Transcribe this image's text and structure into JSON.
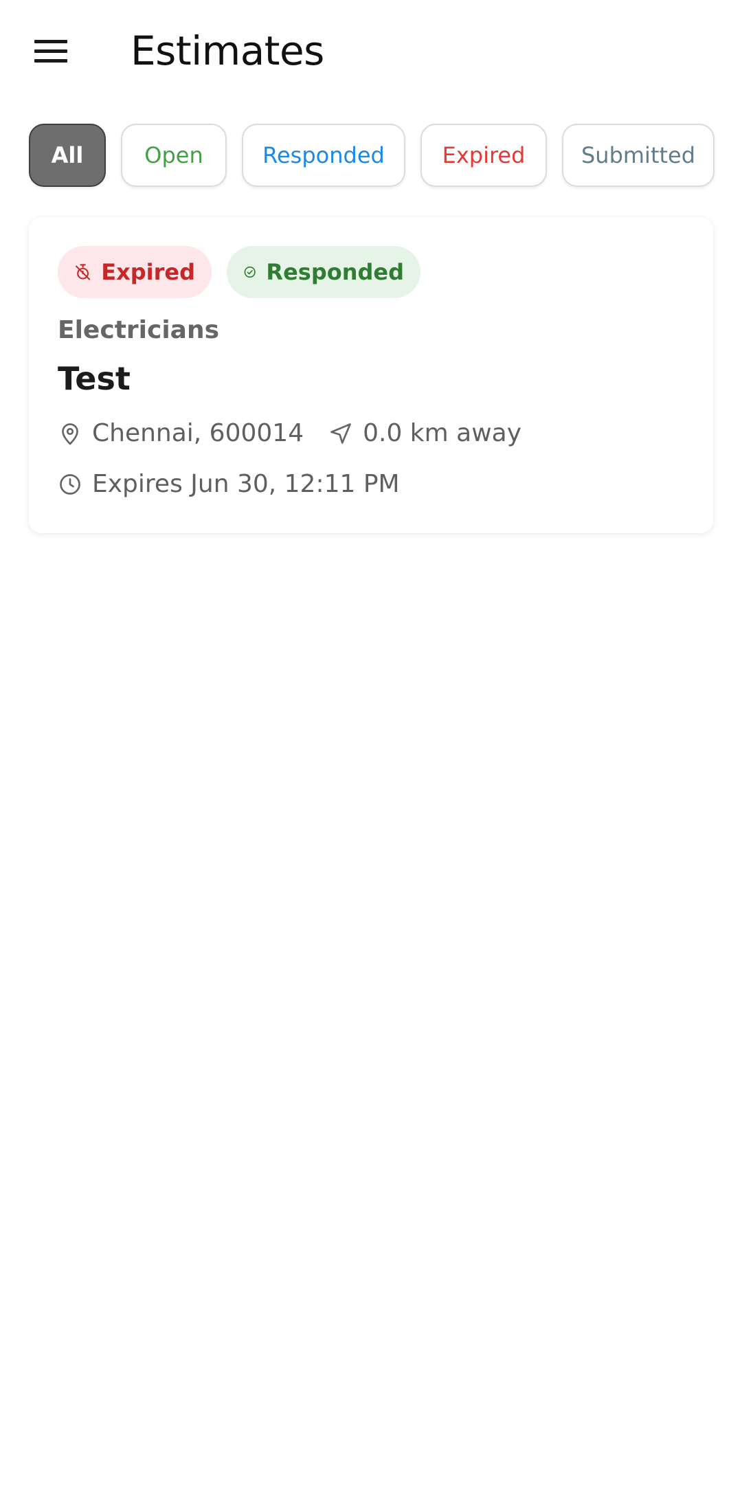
{
  "header": {
    "title": "Estimates",
    "menu_icon": "hamburger-menu-icon"
  },
  "filters": [
    {
      "label": "All",
      "selected": true,
      "color": "#ffffff"
    },
    {
      "label": "Open",
      "selected": false,
      "color": "#43a047"
    },
    {
      "label": "Responded",
      "selected": false,
      "color": "#1e88e5"
    },
    {
      "label": "Expired",
      "selected": false,
      "color": "#e53935"
    },
    {
      "label": "Submitted",
      "selected": false,
      "color": "#607d8b"
    }
  ],
  "estimates": [
    {
      "badges": [
        {
          "label": "Expired",
          "icon": "timer-off-icon",
          "bg": "#fde7ea",
          "color": "#c62828"
        },
        {
          "label": "Responded",
          "icon": "check-circle-icon",
          "bg": "#e6f4e8",
          "color": "#2e7d32"
        }
      ],
      "category": "Electricians",
      "title": "Test",
      "location": "Chennai, 600014",
      "distance": "0.0 km away",
      "expiry": "Expires Jun 30, 12:11 PM"
    }
  ]
}
